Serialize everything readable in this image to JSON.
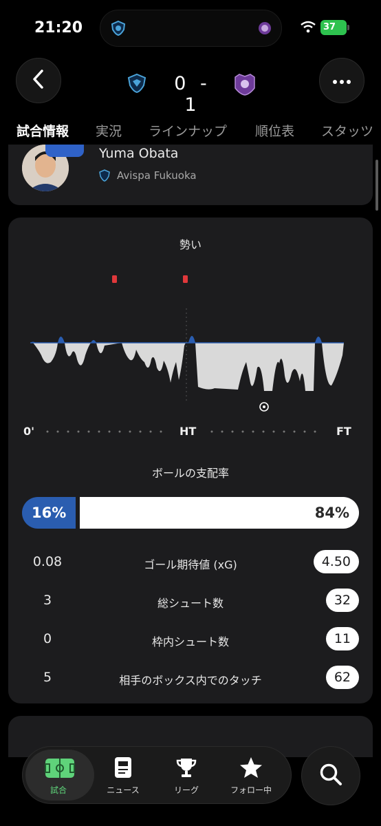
{
  "status_bar": {
    "time": "21:20",
    "battery": "37"
  },
  "match": {
    "score": "0 - 1"
  },
  "tabs": [
    "試合情報",
    "実況",
    "ラインナップ",
    "順位表",
    "スタッツ"
  ],
  "player": {
    "name": "Yuma Obata",
    "team": "Avispa Fukuoka"
  },
  "momentum": {
    "title": "勢い",
    "timeline": {
      "start": "0'",
      "half": "HT",
      "end": "FT"
    }
  },
  "possession": {
    "title": "ボールの支配率",
    "home": "16%",
    "away": "84%",
    "home_fraction": 0.16
  },
  "stats": [
    {
      "home": "0.08",
      "label": "ゴール期待値 (xG)",
      "away": "4.50"
    },
    {
      "home": "3",
      "label": "総シュート数",
      "away": "32"
    },
    {
      "home": "0",
      "label": "枠内シュート数",
      "away": "11"
    },
    {
      "home": "5",
      "label": "相手のボックス内でのタッチ",
      "away": "62"
    }
  ],
  "nav": [
    {
      "label": "試合",
      "icon": "pitch-icon"
    },
    {
      "label": "ニュース",
      "icon": "news-icon"
    },
    {
      "label": "リーグ",
      "icon": "trophy-icon"
    },
    {
      "label": "フォロー中",
      "icon": "star-icon"
    }
  ],
  "colors": {
    "home_team": "#2a5db0",
    "away_team": "#ffffff",
    "active_nav": "#5fd37a",
    "card": "#1c1c1e",
    "red_card": "#e0383b"
  }
}
